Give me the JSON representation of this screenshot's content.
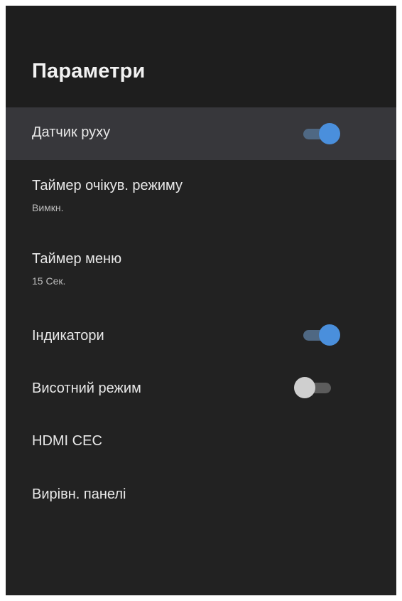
{
  "header": {
    "title": "Параметри"
  },
  "menu": {
    "items": [
      {
        "label": "Датчик руху",
        "toggle": "on",
        "focused": true
      },
      {
        "label": "Таймер очікув. режиму",
        "value": "Вимкн."
      },
      {
        "label": "Таймер меню",
        "value": "15 Сек."
      },
      {
        "label": "Індикатори",
        "toggle": "on"
      },
      {
        "label": "Висотний режим",
        "toggle": "off"
      },
      {
        "label": "HDMI CEC"
      },
      {
        "label": "Вирівн. панелі"
      }
    ]
  },
  "colors": {
    "background": "#222222",
    "header_background": "#1e1e1e",
    "focused_row": "#37373b",
    "toggle_on_thumb": "#4a8fdc",
    "toggle_on_track": "#4f6883",
    "toggle_off_thumb": "#cfcfcf",
    "toggle_off_track": "#5c5c5c"
  }
}
